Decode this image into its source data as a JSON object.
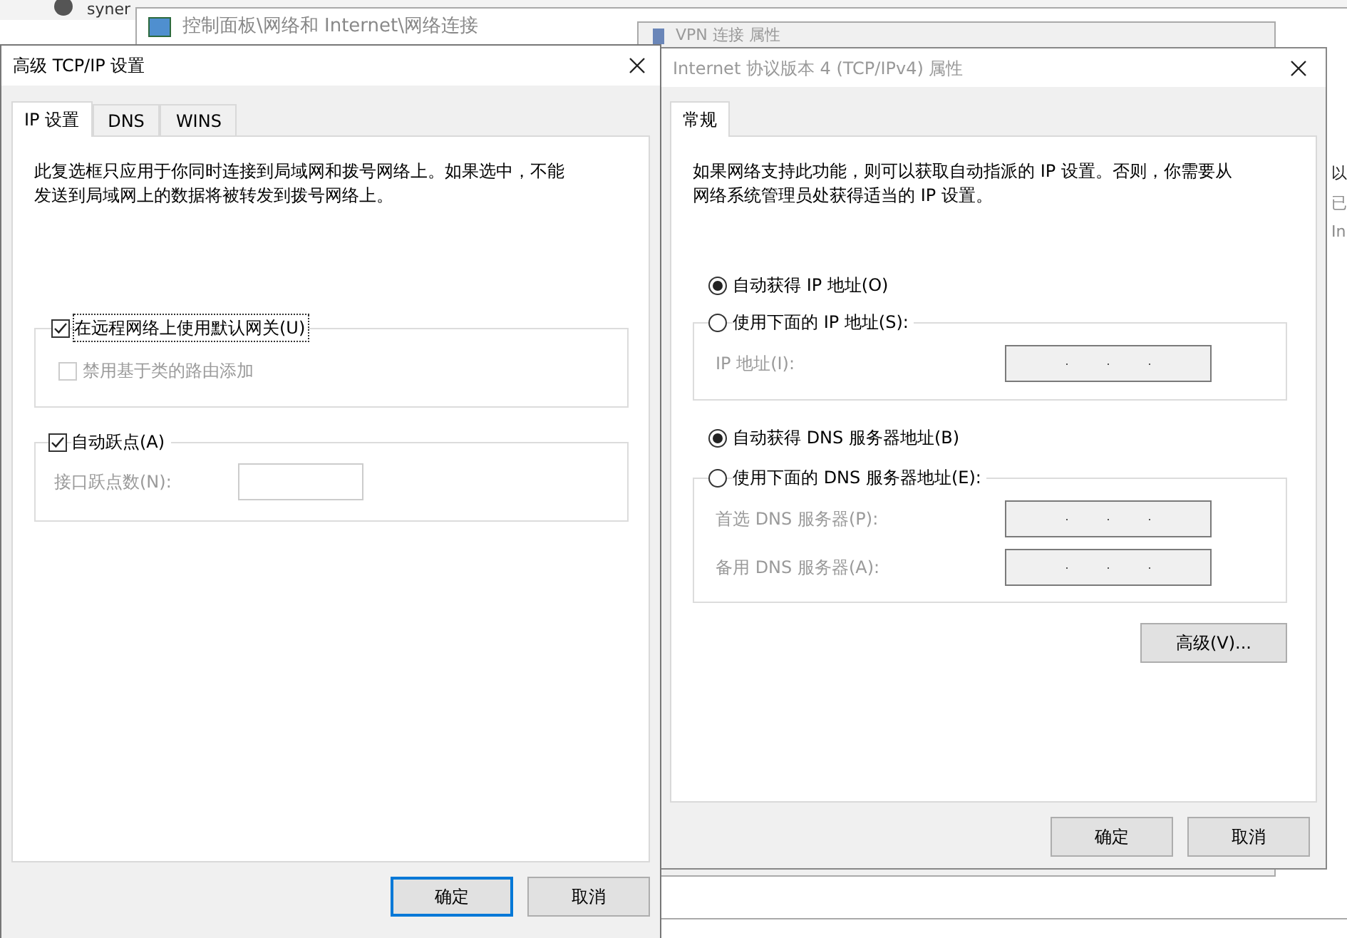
{
  "background": {
    "browser_tab": "syner",
    "explorer_title": "控制面板\\网络和 Internet\\网络连接",
    "vpn_title": "VPN 连接 属性",
    "side_texts": [
      "以",
      "已",
      "In"
    ]
  },
  "advanced_dialog": {
    "title": "高级 TCP/IP 设置",
    "tabs": [
      {
        "label": "IP 设置",
        "selected": true
      },
      {
        "label": "DNS",
        "selected": false
      },
      {
        "label": "WINS",
        "selected": false
      }
    ],
    "description": "此复选框只应用于你同时连接到局域网和拨号网络上。如果选中，不能发送到局域网上的数据将被转发到拨号网络上。",
    "gateway": {
      "label": "在远程网络上使用默认网关(U)",
      "checked": true,
      "focused": true
    },
    "class_route": {
      "label": "禁用基于类的路由添加",
      "checked": false,
      "disabled": true
    },
    "auto_metric": {
      "label": "自动跃点(A)",
      "checked": true
    },
    "metric_field": {
      "label": "接口跃点数(N):",
      "disabled": true
    },
    "buttons": [
      {
        "label": "确定",
        "default": true
      },
      {
        "label": "取消",
        "default": false
      }
    ]
  },
  "ipv4_dialog": {
    "title": "Internet 协议版本 4 (TCP/IPv4) 属性",
    "tabs": [
      {
        "label": "常规",
        "selected": true
      }
    ],
    "description": "如果网络支持此功能，则可以获取自动指派的 IP 设置。否则，你需要从网络系统管理员处获得适当的 IP 设置。",
    "ip_options": [
      {
        "label": "自动获得 IP 地址(O)",
        "selected": true
      },
      {
        "label": "使用下面的 IP 地址(S):",
        "selected": false
      }
    ],
    "ip_fields": [
      {
        "label": "IP 地址(I):",
        "disabled": true
      }
    ],
    "dns_options": [
      {
        "label": "自动获得 DNS 服务器地址(B)",
        "selected": true
      },
      {
        "label": "使用下面的 DNS 服务器地址(E):",
        "selected": false
      }
    ],
    "dns_fields": [
      {
        "label": "首选 DNS 服务器(P):",
        "disabled": true
      },
      {
        "label": "备用 DNS 服务器(A):",
        "disabled": true
      }
    ],
    "advanced_button": "高级(V)...",
    "buttons": [
      {
        "label": "确定",
        "default": false
      },
      {
        "label": "取消",
        "default": false
      }
    ]
  }
}
